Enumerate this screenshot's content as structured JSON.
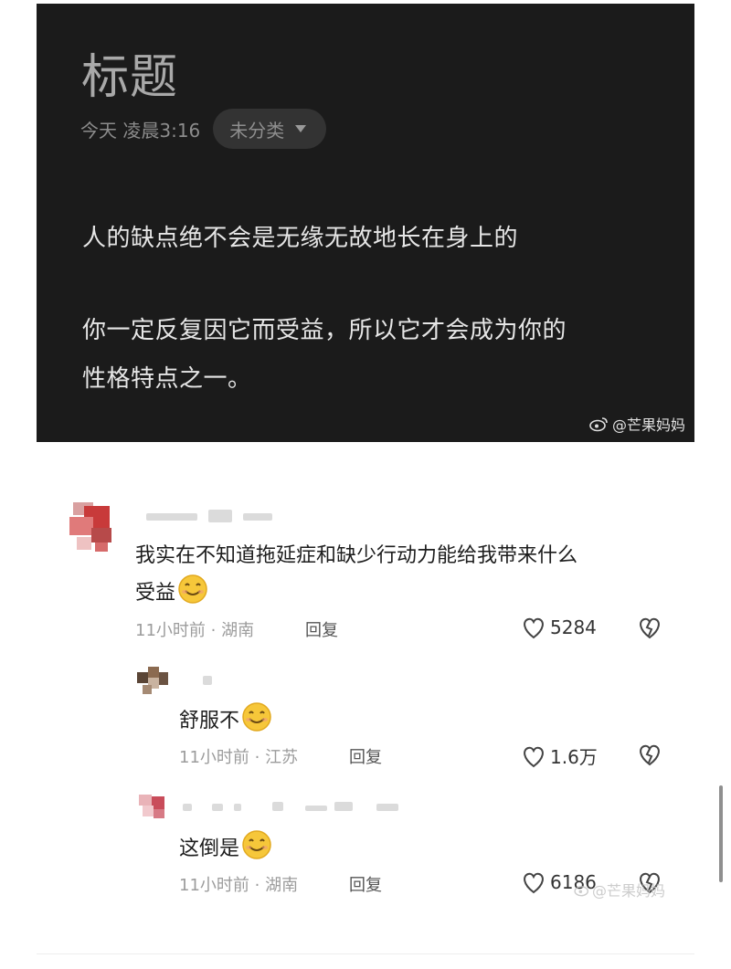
{
  "note": {
    "title": "标题",
    "date": "今天 凌晨3:16",
    "category": "未分类",
    "line1": "人的缺点绝不会是无缘无故地长在身上的",
    "line2": "你一定反复因它而受益，所以它才会成为你的",
    "line3": "性格特点之一。",
    "watermark": "@芒果妈妈"
  },
  "comments": [
    {
      "text_line1": "我实在不知道拖延症和缺少行动力能给我带来什么",
      "text_line2": "受益",
      "time": "11小时前",
      "location": "湖南",
      "reply": "回复",
      "likes": "5284"
    },
    {
      "text_line1": "舒服不",
      "time": "11小时前",
      "location": "江苏",
      "reply": "回复",
      "likes": "1.6万"
    },
    {
      "text_line1": "这倒是",
      "time": "11小时前",
      "location": "湖南",
      "reply": "回复",
      "likes": "6186"
    }
  ],
  "bottom_watermark": "@芒果妈妈",
  "icons": [
    "caret-down-icon",
    "weibo-icon",
    "heart-icon",
    "dislike-heart-icon",
    "smile-emoji-icon"
  ]
}
